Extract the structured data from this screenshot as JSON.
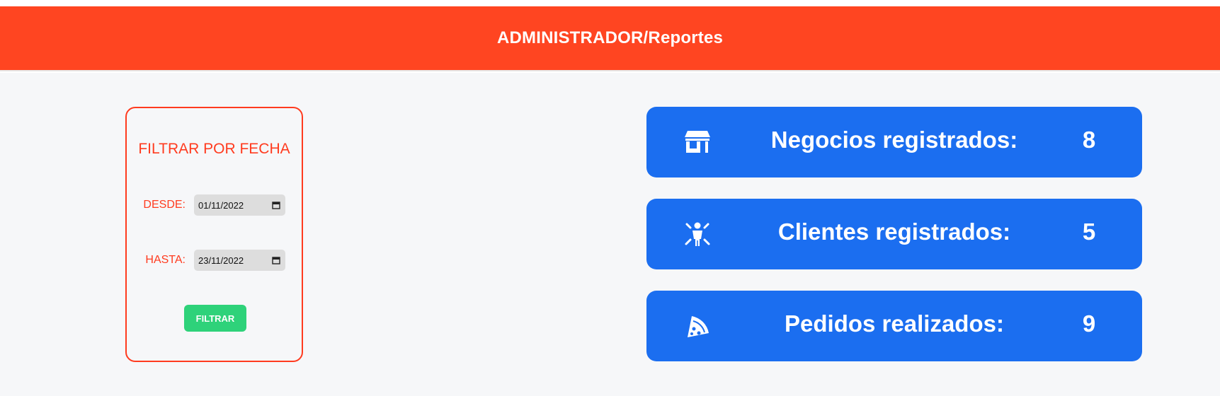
{
  "header": {
    "title": "ADMINISTRADOR/Reportes"
  },
  "filter": {
    "title": "FILTRAR POR FECHA",
    "desde_label": "DESDE:",
    "desde_value": "01/11/2022",
    "hasta_label": "HASTA:",
    "hasta_value": "23/11/2022",
    "button_label": "FILTRAR"
  },
  "stats": [
    {
      "icon": "store-icon",
      "label": "Negocios registrados:",
      "value": "8"
    },
    {
      "icon": "person-icon",
      "label": "Clientes registrados:",
      "value": "5"
    },
    {
      "icon": "pizza-icon",
      "label": "Pedidos realizados:",
      "value": "9"
    }
  ],
  "colors": {
    "header": "#ff4521",
    "accent": "#ff3b1f",
    "card": "#1b6ef0",
    "button": "#2ed27a"
  }
}
